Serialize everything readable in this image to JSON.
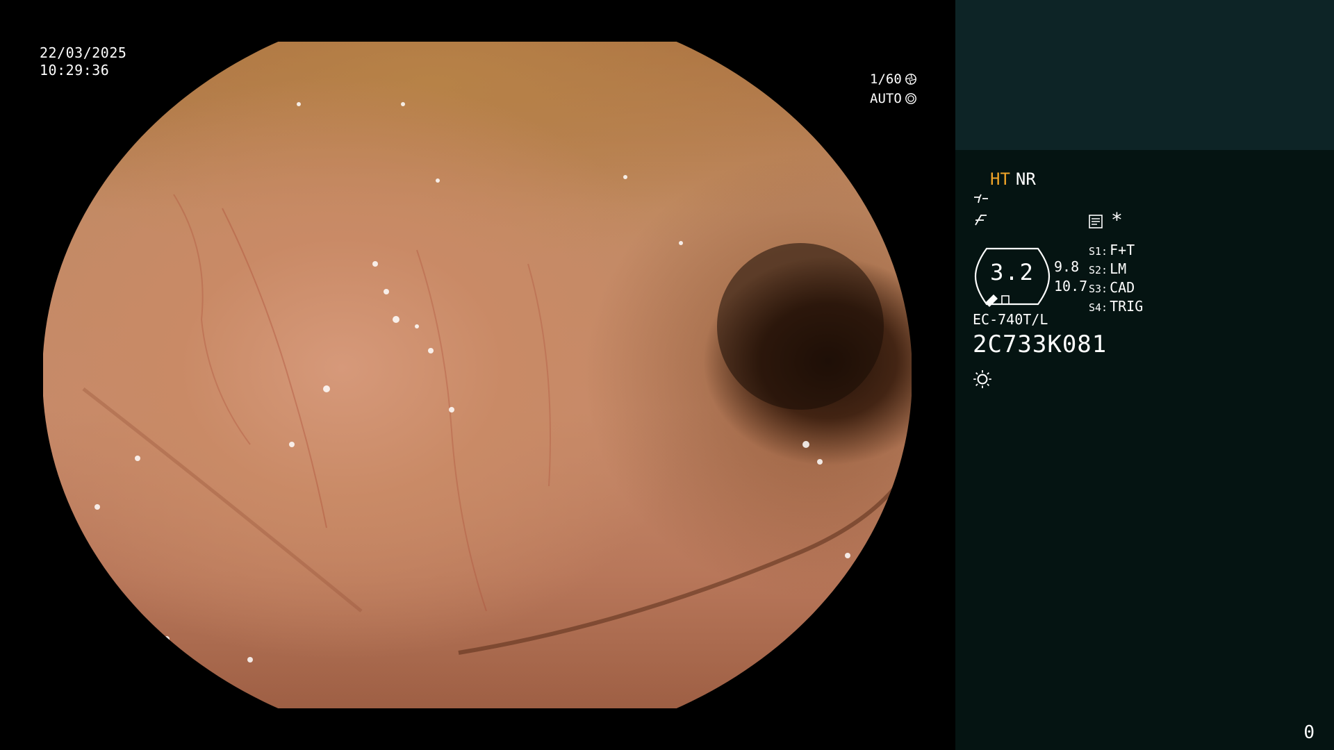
{
  "overlay": {
    "date": "22/03/2025",
    "time": "10:29:36",
    "shutter_speed": "1/60",
    "exposure_mode": "AUTO",
    "shutter_icon": "aperture-icon",
    "auto_icon": "iris-icon"
  },
  "panel": {
    "mode_ht": "HT",
    "mode_nr": "NR",
    "icons": [
      "structure-enhance-icon",
      "color-enhance-icon",
      "recording-icon",
      "asterisk-icon",
      "lamp-icon"
    ],
    "asterisk": "*",
    "zoom": {
      "value": "3.2",
      "right_top": "9.8",
      "right_bottom": "10.7"
    },
    "switches": [
      {
        "key": "S1:",
        "value": "F+T"
      },
      {
        "key": "S2:",
        "value": "LM"
      },
      {
        "key": "S3:",
        "value": "CAD"
      },
      {
        "key": "S4:",
        "value": "TRIG"
      }
    ],
    "scope_model": "EC-740T/L",
    "scope_serial": "2C733K081",
    "counter": "0"
  },
  "colors": {
    "ht_accent": "#f0a428",
    "panel_top": "#0d2426",
    "panel_bottom": "#051412"
  }
}
